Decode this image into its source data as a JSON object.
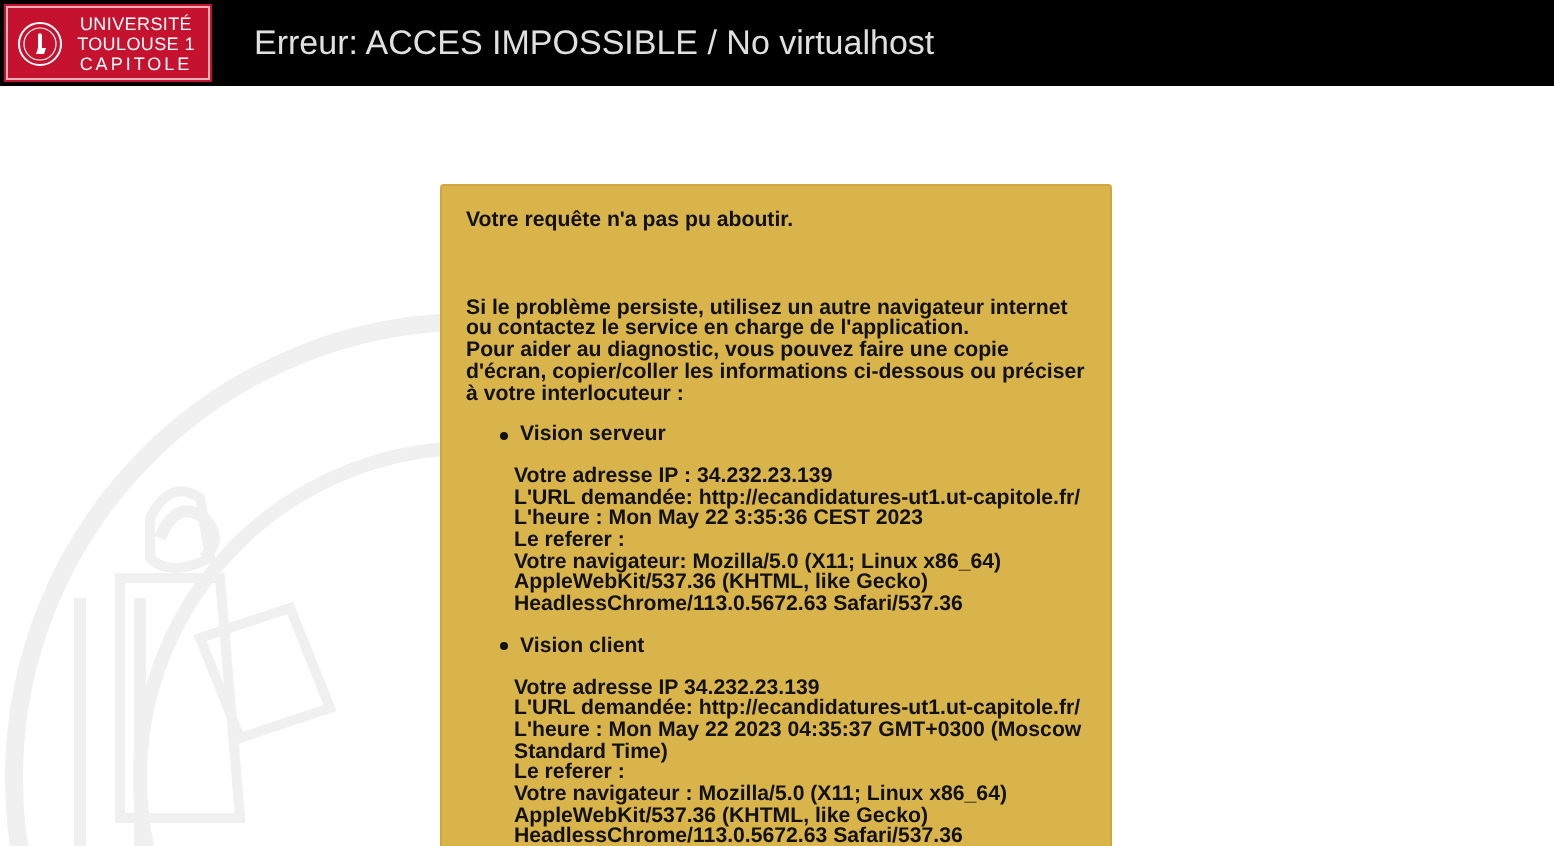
{
  "header": {
    "logo_lines": [
      "UNIVERSITÉ",
      "TOULOUSE 1",
      "CAPITOLE"
    ],
    "title": "Erreur: ACCES IMPOSSIBLE / No virtualhost"
  },
  "card": {
    "intro": "Votre requête n'a pas pu aboutir.",
    "help": [
      "Si le problème persiste, utilisez un autre navigateur internet ou contactez le service en charge de l'application.",
      "Pour aider au diagnostic, vous pouvez faire une copie d'écran, copier/coller les informations ci-dessous ou préciser à votre interlocuteur :"
    ],
    "sections": [
      {
        "heading": "Vision serveur",
        "lines": [
          "Votre adresse IP : 34.232.23.139",
          "L'URL demandée: http://ecandidatures-ut1.ut-capitole.fr/",
          "L'heure : Mon May 22 3:35:36 CEST 2023",
          "Le referer :",
          "Votre navigateur: Mozilla/5.0 (X11; Linux x86_64) AppleWebKit/537.36 (KHTML, like Gecko) HeadlessChrome/113.0.5672.63 Safari/537.36"
        ]
      },
      {
        "heading": "Vision client",
        "lines": [
          "Votre adresse IP 34.232.23.139",
          "L'URL demandée: http://ecandidatures-ut1.ut-capitole.fr/",
          "L'heure : Mon May 22 2023 04:35:37 GMT+0300 (Moscow Standard Time)",
          "Le referer :",
          "Votre navigateur : Mozilla/5.0 (X11; Linux x86_64) AppleWebKit/537.36 (KHTML, like Gecko) HeadlessChrome/113.0.5672.63 Safari/537.36"
        ]
      }
    ]
  }
}
